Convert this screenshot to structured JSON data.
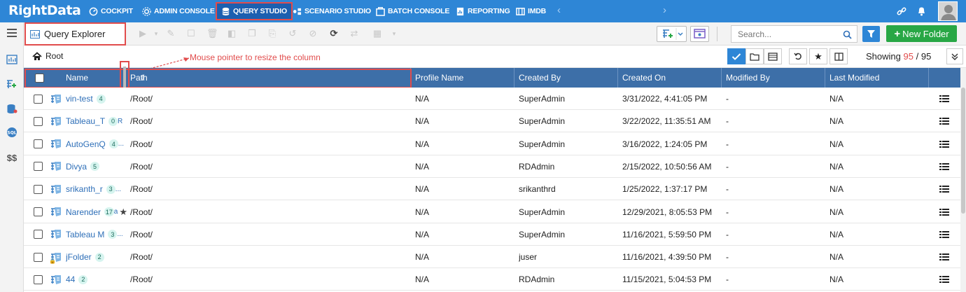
{
  "brand": {
    "logo_text": "RightData",
    "color": "#2e86d6"
  },
  "nav": {
    "items": [
      {
        "label": "COCKPIT",
        "icon": "cockpit-icon"
      },
      {
        "label": "ADMIN CONSOLE",
        "icon": "gear-icon"
      },
      {
        "label": "QUERY STUDIO",
        "icon": "database-icon",
        "active": true
      },
      {
        "label": "SCENARIO STUDIO",
        "icon": "scenario-icon"
      },
      {
        "label": "BATCH CONSOLE",
        "icon": "batch-icon"
      },
      {
        "label": "REPORTING",
        "icon": "report-icon"
      },
      {
        "label": "IMDB",
        "icon": "imdb-icon"
      }
    ],
    "prev_arrow": "‹",
    "next_arrow": "›"
  },
  "toolbar": {
    "title": "Query Explorer",
    "search_placeholder": "Search...",
    "new_folder_label": "New Folder"
  },
  "breadcrumb": {
    "label": "Root"
  },
  "annotation": "Mouse pointer to resize the column",
  "showing": {
    "prefix": "Showing",
    "count": "95",
    "sep": "/",
    "total": "95"
  },
  "table": {
    "columns": [
      "Name",
      "Path",
      "Profile Name",
      "Created By",
      "Created On",
      "Modified By",
      "Last Modified"
    ],
    "rows": [
      {
        "name": "vin-test",
        "badge": "4",
        "path": "/Root/",
        "profile": "N/A",
        "created_by": "SuperAdmin",
        "created_on": "3/31/2022, 4:41:05 PM",
        "modified_by": "-",
        "last_modified": "N/A"
      },
      {
        "name": "Tableau_T",
        "badge": "0",
        "suffix": "R",
        "path": "/Root/",
        "profile": "N/A",
        "created_by": "SuperAdmin",
        "created_on": "3/22/2022, 11:35:51 AM",
        "modified_by": "-",
        "last_modified": "N/A"
      },
      {
        "name": "AutoGenQ",
        "badge": "4",
        "suffix": "...",
        "path": "/Root/",
        "profile": "N/A",
        "created_by": "SuperAdmin",
        "created_on": "3/16/2022, 1:24:05 PM",
        "modified_by": "-",
        "last_modified": "N/A"
      },
      {
        "name": "Divya",
        "badge": "5",
        "path": "/Root/",
        "profile": "N/A",
        "created_by": "RDAdmin",
        "created_on": "2/15/2022, 10:50:56 AM",
        "modified_by": "-",
        "last_modified": "N/A"
      },
      {
        "name": "srikanth_r",
        "badge": "3",
        "suffix": "...",
        "path": "/Root/",
        "profile": "N/A",
        "created_by": "srikanthrd",
        "created_on": "1/25/2022, 1:37:17 PM",
        "modified_by": "-",
        "last_modified": "N/A"
      },
      {
        "name": "Narender",
        "badge": "17",
        "suffix": "a",
        "star": true,
        "path": "/Root/",
        "profile": "N/A",
        "created_by": "SuperAdmin",
        "created_on": "12/29/2021, 8:05:53 PM",
        "modified_by": "-",
        "last_modified": "N/A"
      },
      {
        "name": "Tableau M",
        "badge": "3",
        "suffix": "...",
        "path": "/Root/",
        "profile": "N/A",
        "created_by": "SuperAdmin",
        "created_on": "11/16/2021, 5:59:50 PM",
        "modified_by": "-",
        "last_modified": "N/A"
      },
      {
        "name": "jFolder",
        "badge": "2",
        "lock": true,
        "path": "/Root/",
        "profile": "N/A",
        "created_by": "juser",
        "created_on": "11/16/2021, 4:39:50 PM",
        "modified_by": "-",
        "last_modified": "N/A"
      },
      {
        "name": "44",
        "badge": "2",
        "path": "/Root/",
        "profile": "N/A",
        "created_by": "RDAdmin",
        "created_on": "11/15/2021, 5:04:53 PM",
        "modified_by": "-",
        "last_modified": "N/A"
      }
    ]
  },
  "rail": {
    "dollar_label": "$$"
  },
  "colors": {
    "accent": "#2e86d6",
    "header": "#3d6fa8",
    "annotation": "#e14c4c",
    "success": "#28a745"
  }
}
